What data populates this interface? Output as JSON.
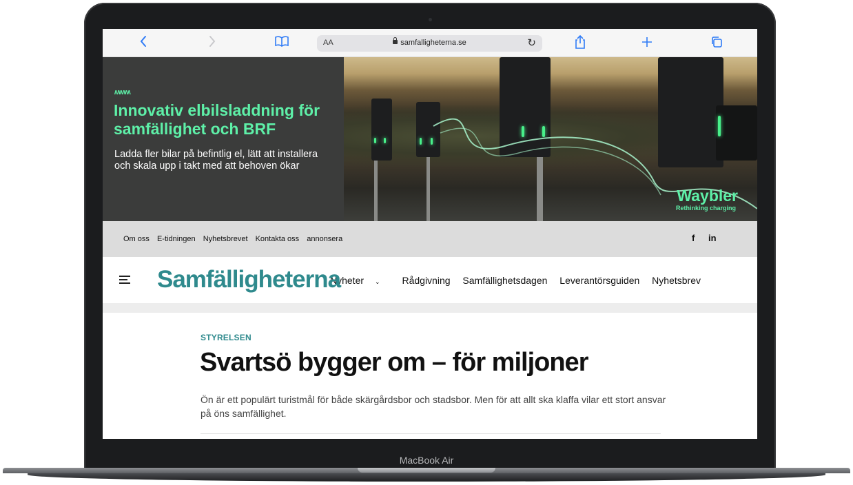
{
  "device": {
    "label": "MacBook Air"
  },
  "browser": {
    "text_size_label": "AA",
    "url": "samfalligheterna.se",
    "icons": [
      "back-icon",
      "forward-icon",
      "bookmarks-icon",
      "reload-icon",
      "share-icon",
      "new-tab-icon",
      "tabs-icon"
    ]
  },
  "ad": {
    "logo": "ʍʍʍ",
    "title": "Innovativ elbilsladdning för samfällighet och BRF",
    "subtitle": "Ladda fler bilar på befintlig el, lätt att installera och skala upp i takt med att behoven ökar",
    "brand": "Waybler",
    "tagline": "Rethinking charging",
    "accent_color": "#5ef0a8"
  },
  "topbar": {
    "links": [
      "Om oss",
      "E-tidningen",
      "Nyhetsbrevet",
      "Kontakta oss",
      "annonsera"
    ],
    "social": [
      "f",
      "in"
    ]
  },
  "nav": {
    "logo": "Samfälligheterna",
    "items": [
      "Nyheter",
      "Rådgivning",
      "Samfällighetsdagen",
      "Leverantörsguiden",
      "Nyhetsbrev"
    ],
    "brand_color": "#2f8a8d"
  },
  "article": {
    "category": "STYRELSEN",
    "headline": "Svartsö bygger om – för miljoner",
    "lead": "Ön är ett populärt turistmål för både skärgårdsbor och stadsbor. Men för att allt ska klaffa vilar ett stort ansvar på öns samfällighet."
  }
}
